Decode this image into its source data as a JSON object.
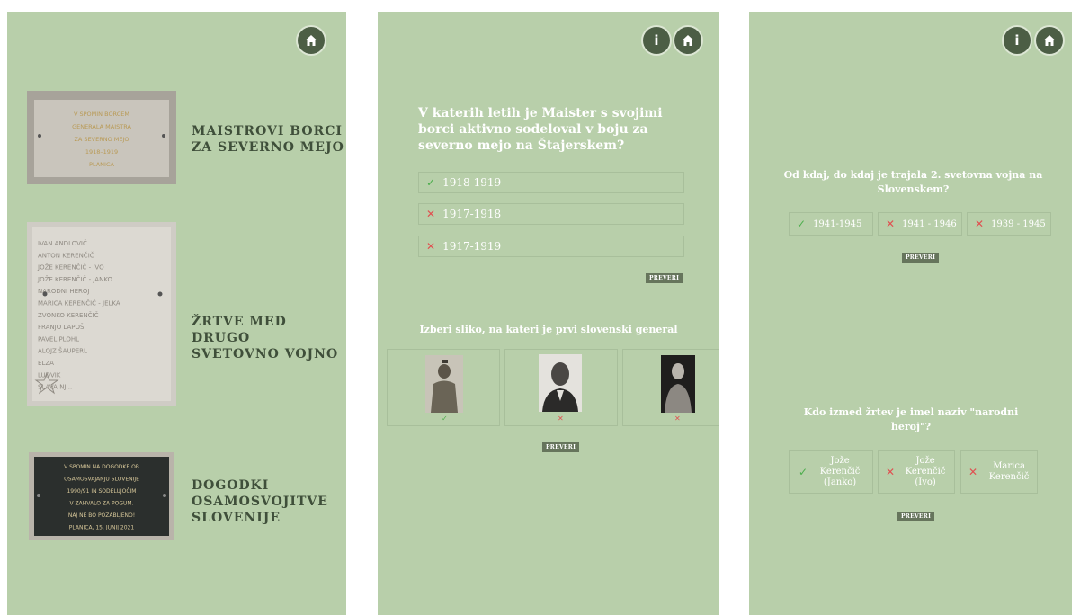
{
  "screen1": {
    "plaques": [
      {
        "title": "MAISTROVI BORCI\nZA SEVERNO MEJO",
        "inscription": [
          "V SPOMIN BORCEM",
          "GENERALA MAISTRA",
          "ZA SEVERNO MEJO",
          "1918–1919",
          "PLANICA"
        ]
      },
      {
        "title": "ŽRTVE MED DRUGO\nSVETOVNO VOJNO",
        "inscription": [
          "IVAN ANDLOVIČ",
          "ANTON KERENČIČ",
          "JOŽE KERENČIČ - IVO",
          "JOŽE KERENČIČ - JANKO",
          "NARODNI HEROJ",
          "MARICA KERENČIČ - JELKA",
          "ZVONKO KERENČIČ",
          "FRANJO LAPOŠ",
          "PAVEL PLOHL",
          "ALOJZ ŠAUPERL",
          "ELZA",
          "LUDVIK",
          "SLAVA NJ..."
        ]
      },
      {
        "title": "DOGODKI\nOSAMOSVOJITVE\nSLOVENIJE",
        "inscription": [
          "V SPOMIN NA DOGODKE OB",
          "OSAMOSVAJANJU SLOVENIJE",
          "1990/91 IN SODELUJOČIM",
          "V ZAHVALO ZA POGUM.",
          "NAJ NE BO POZABLJENO!",
          "PLANICA, 15. JUNIJ 2021"
        ]
      }
    ]
  },
  "screen2": {
    "question1": "V katerih letih je Maister s svojimi borci aktivno sodeloval v boju za severno mejo na Štajerskem?",
    "options1": [
      {
        "label": "1918-1919",
        "mark": "✓"
      },
      {
        "label": "1917-1918",
        "mark": "✕"
      },
      {
        "label": "1917-1919",
        "mark": "✕"
      }
    ],
    "check_label": "PREVERI",
    "question2": "Izberi sliko, na kateri je prvi slovenski general",
    "image_marks": [
      "✓",
      "✕",
      "✕"
    ],
    "check_label2": "PREVERI"
  },
  "screen3": {
    "question1": "Od kdaj, do kdaj je trajala 2. svetovna vojna na Slovenskem?",
    "options1": [
      {
        "label": "1941-1945",
        "mark": "✓"
      },
      {
        "label": "1941 - 1946",
        "mark": "✕"
      },
      {
        "label": "1939 - 1945",
        "mark": "✕"
      }
    ],
    "check_label": "PREVERI",
    "question2": "Kdo izmed žrtev je imel naziv \"narodni heroj\"?",
    "options2": [
      {
        "label": "Jože Kerenčič (Janko)",
        "mark": "✓"
      },
      {
        "label": "Jože Kerenčič (Ivo)",
        "mark": "✕"
      },
      {
        "label": "Marica Kerenčič",
        "mark": "✕"
      }
    ],
    "check_label2": "PREVERI"
  },
  "colors": {
    "background": "#b8cfaa",
    "button": "#4c5e45",
    "correct": "#4cae4c",
    "wrong": "#e05050"
  },
  "icons": [
    "home-icon",
    "info-icon"
  ]
}
